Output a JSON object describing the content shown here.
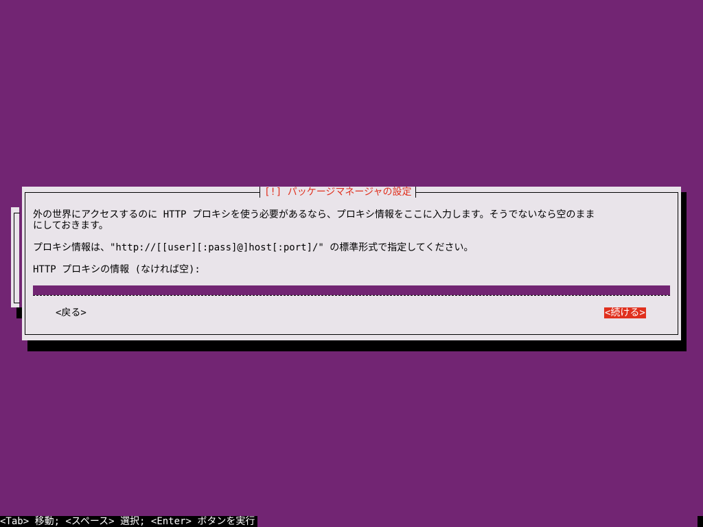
{
  "dialog": {
    "title": "[!] パッケージマネージャの設定",
    "description_line1": "外の世界にアクセスするのに HTTP プロキシを使う必要があるなら、プロキシ情報をここに入力します。そうでないなら空のまま",
    "description_line2": "にしておきます。",
    "format_hint": "プロキシ情報は、\"http://[[user][:pass]@]host[:port]/\" の標準形式で指定してください。",
    "field_label": "HTTP プロキシの情報 (なければ空):",
    "field_value": "",
    "back_button": "<戻る>",
    "continue_button": "<続ける>"
  },
  "statusbar": {
    "help": "<Tab> 移動; <スペース> 選択; <Enter> ボタンを実行"
  },
  "colors": {
    "background": "#722573",
    "dialog": "#e9e4ea",
    "accent": "#e0301e"
  }
}
